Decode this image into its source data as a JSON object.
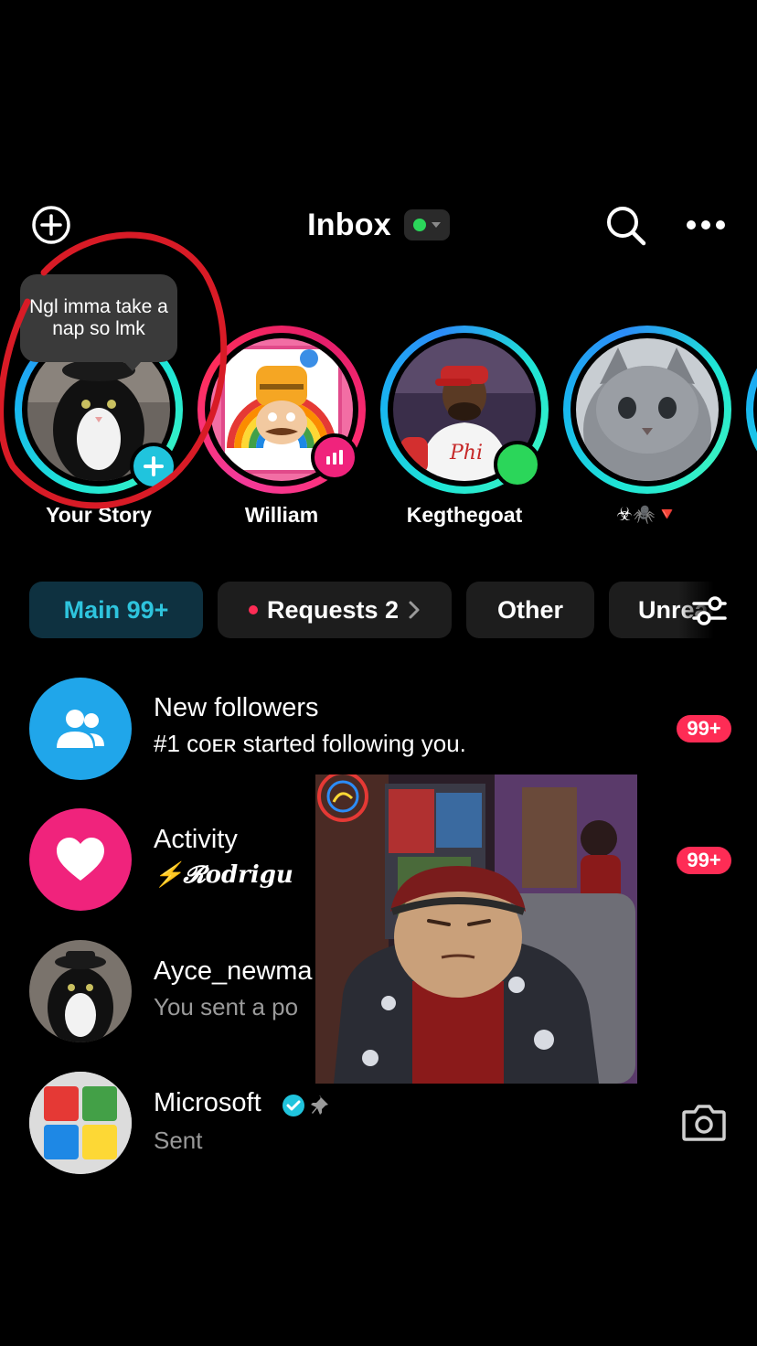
{
  "header": {
    "title": "Inbox",
    "add_icon": "plus-circle-icon",
    "search_icon": "search-icon",
    "more_icon": "more-horizontal-icon",
    "status_color": "#2bd65a"
  },
  "tooltip": {
    "text": "Ngl imma take a nap so lmk"
  },
  "stories": [
    {
      "label": "Your Story"
    },
    {
      "label": "William"
    },
    {
      "label": "Kegthegoat"
    },
    {
      "label": "☣︎🕷️🔻"
    }
  ],
  "filters": {
    "main": "Main 99+",
    "requests": "Requests 2",
    "other": "Other",
    "unread": "Unread",
    "filter_icon": "sliders-icon"
  },
  "rows": {
    "followers": {
      "title": "New followers",
      "sub": "#1 ᴄᴏᴇʀ started following you.",
      "count": "99+"
    },
    "activity": {
      "title": "Activity",
      "sub": "⚡𝓡𝒐𝒅𝒓𝒊𝒈𝒖",
      "count": "99+"
    },
    "ayce": {
      "title": "Ayce_newma",
      "sub": "You sent a po"
    },
    "microsoft": {
      "title": "Microsoft",
      "sub": "Sent",
      "camera_icon": "camera-icon"
    }
  },
  "colors": {
    "accent": "#2ec4dd",
    "badge": "#fe2c55",
    "followers_bg": "#20a6ea",
    "activity_bg": "#f0237c"
  }
}
